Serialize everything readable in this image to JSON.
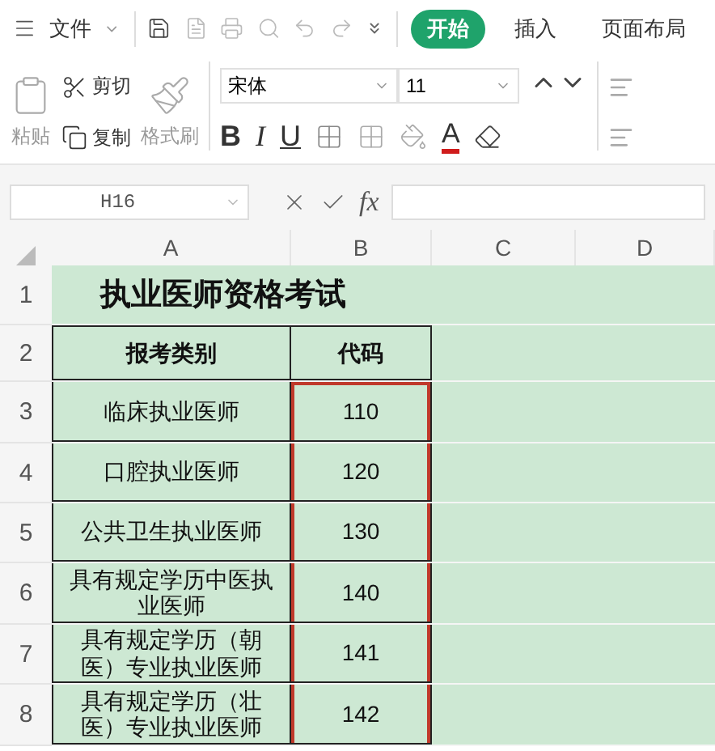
{
  "menu_bar": {
    "file_label": "文件",
    "tabs": [
      {
        "label": "开始",
        "selected": true
      },
      {
        "label": "插入",
        "selected": false
      },
      {
        "label": "页面布局",
        "selected": false
      }
    ]
  },
  "ribbon": {
    "paste_label": "粘贴",
    "cut_label": "剪切",
    "copy_label": "复制",
    "format_painter_label": "格式刷",
    "font_name": "宋体",
    "font_size": "11",
    "bold": "B",
    "italic": "I",
    "underline": "U",
    "font_color_letter": "A"
  },
  "formula_bar": {
    "name_box": "H16",
    "fx": "fx"
  },
  "columns": [
    "A",
    "B",
    "C",
    "D"
  ],
  "rows": [
    {
      "number": "1",
      "kind": "title",
      "a": "执业医师资格考试"
    },
    {
      "number": "2",
      "kind": "header",
      "a": "报考类别",
      "b": "代码",
      "b_selected": false
    },
    {
      "number": "3",
      "kind": "data",
      "a": "临床执业医师",
      "b": "110",
      "b_selected": true
    },
    {
      "number": "4",
      "kind": "data",
      "a": "口腔执业医师",
      "b": "120",
      "b_selected": true
    },
    {
      "number": "5",
      "kind": "data",
      "a": "公共卫生执业医师",
      "b": "130",
      "b_selected": true
    },
    {
      "number": "6",
      "kind": "data",
      "a": "具有规定学历中医执业医师",
      "b": "140",
      "b_selected": true
    },
    {
      "number": "7",
      "kind": "data",
      "a": "具有规定学历（朝医）专业执业医师",
      "b": "141",
      "b_selected": true
    },
    {
      "number": "8",
      "kind": "data",
      "a": "具有规定学历（壮医）专业执业医师",
      "b": "142",
      "b_selected": true
    }
  ]
}
